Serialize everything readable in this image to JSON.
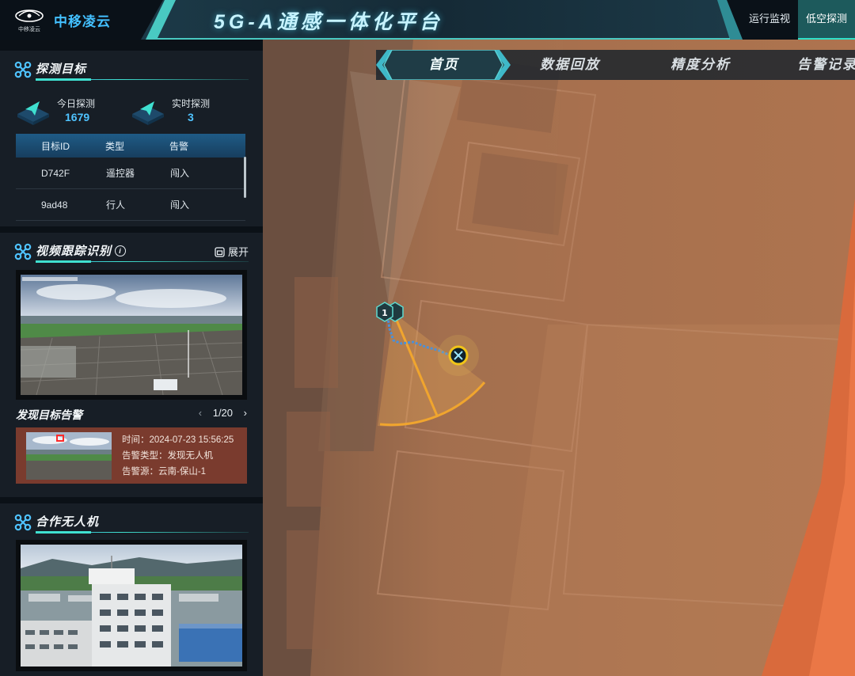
{
  "header": {
    "brand": "中移凌云",
    "logo_caption": "中移凌云",
    "title": "5G-A通感一体化平台",
    "nav": [
      {
        "label": "运行监视",
        "active": false
      },
      {
        "label": "低空探测",
        "active": true
      }
    ]
  },
  "tabs": [
    {
      "label": "首页",
      "active": true
    },
    {
      "label": "数据回放",
      "active": false
    },
    {
      "label": "精度分析",
      "active": false
    },
    {
      "label": "告警记录",
      "active": false
    }
  ],
  "detection": {
    "title": "探测目标",
    "today_label": "今日探测",
    "today_value": "1679",
    "realtime_label": "实时探测",
    "realtime_value": "3",
    "columns": [
      "目标ID",
      "类型",
      "告警"
    ],
    "rows": [
      {
        "id": "D742F",
        "type": "遥控器",
        "alarm": "闯入"
      },
      {
        "id": "9ad48",
        "type": "行人",
        "alarm": "闯入"
      }
    ]
  },
  "video": {
    "title": "视频跟踪识别",
    "expand_label": "展开",
    "info_glyph": "i",
    "alarm_title": "发现目标告警",
    "pager": {
      "prev": "‹",
      "current": "1/20",
      "next": "›"
    },
    "alarm": {
      "time": "时间：2024-07-23 15:56:25",
      "type": "告警类型：发现无人机",
      "source": "告警源：云南-保山-1"
    }
  },
  "cooperative": {
    "title": "合作无人机"
  },
  "map": {
    "marker_label": "1",
    "colors": {
      "sector": "#f0a52e",
      "track": "#4a90d9",
      "drone": "#f0c419"
    }
  },
  "icons": [
    "app-logo-icon",
    "drone-quad-icon",
    "paper-plane-icon",
    "info-icon",
    "expand-icon",
    "chevron-left-icon",
    "chevron-right-icon",
    "hexagon-marker-icon",
    "target-drone-icon"
  ]
}
